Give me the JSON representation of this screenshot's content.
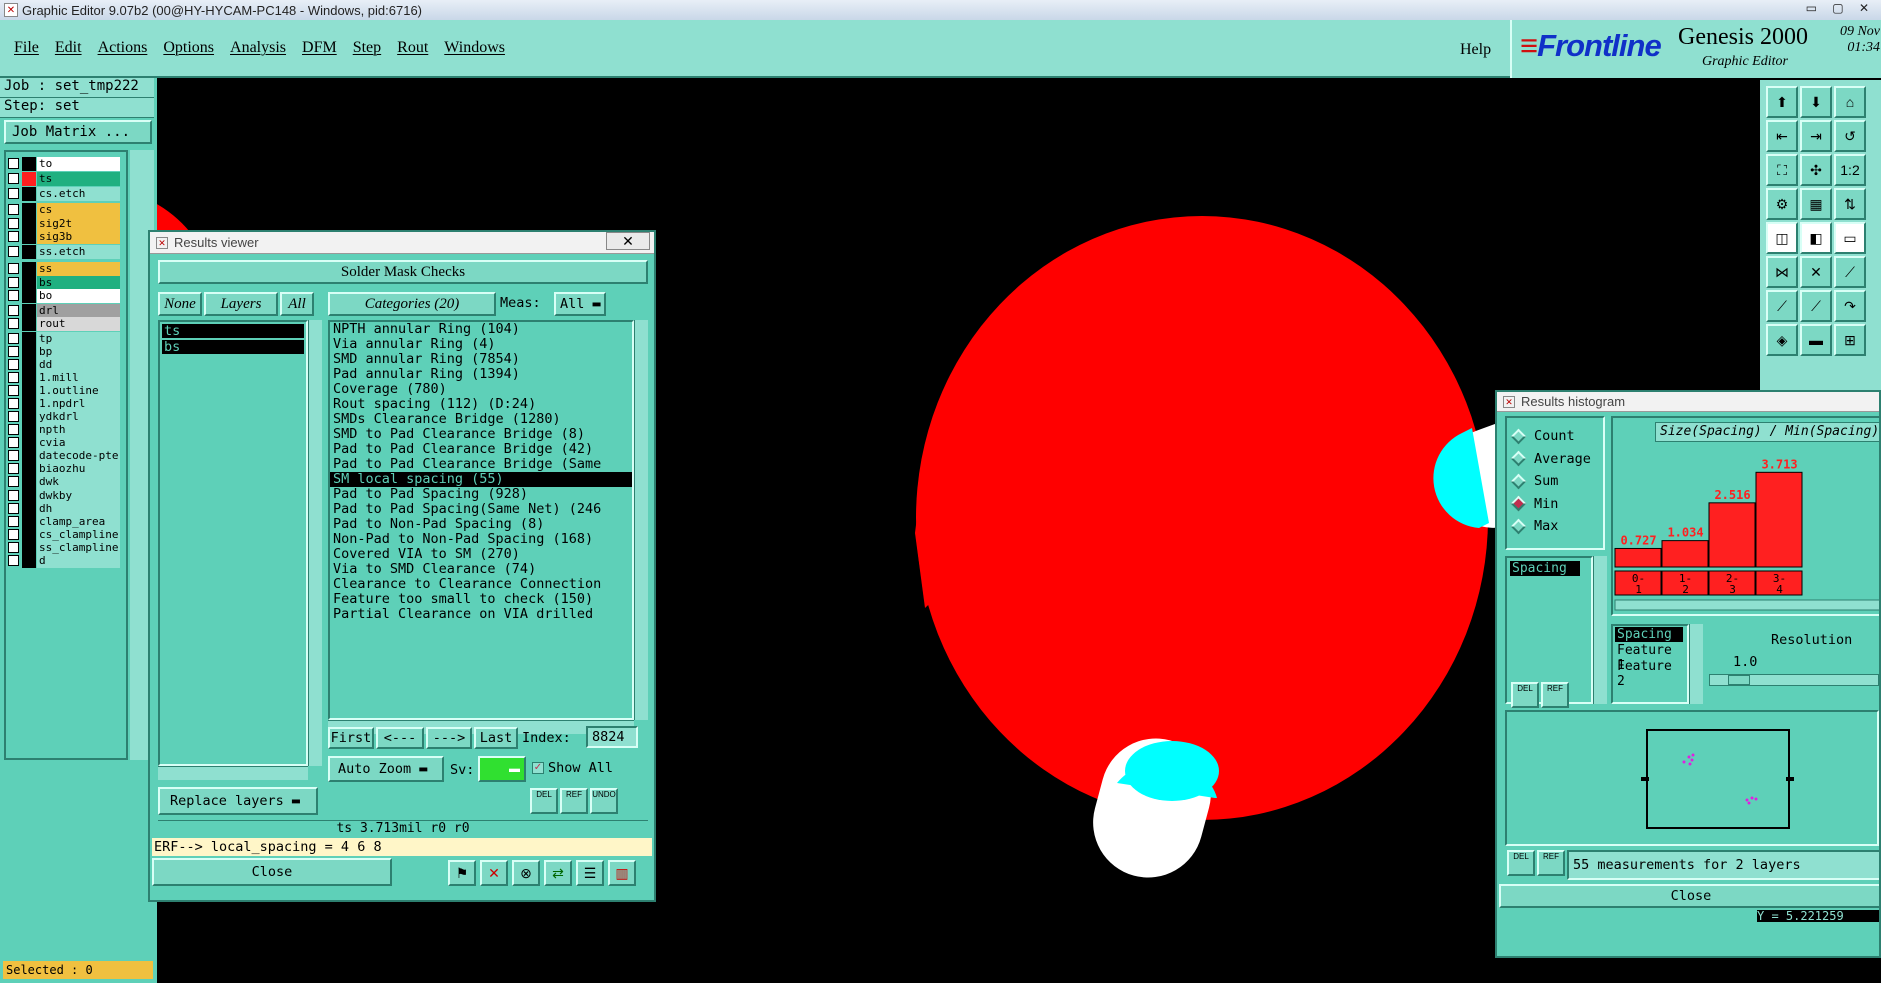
{
  "window": {
    "title": "Graphic Editor 9.07b2 (00@HY-HYCAM-PC148 - Windows, pid:6716)"
  },
  "menu": [
    "File",
    "Edit",
    "Actions",
    "Options",
    "Analysis",
    "DFM",
    "Step",
    "Rout",
    "Windows"
  ],
  "help": "Help",
  "brand": {
    "logo": "Frontline",
    "product": "Genesis 2000",
    "subtitle": "Graphic Editor",
    "date": "09  Nov",
    "time": "01:34"
  },
  "job": {
    "job_line": "Job : set_tmp222",
    "step_line": "Step: set",
    "job_matrix": "Job Matrix ..."
  },
  "layers": [
    {
      "name": "to",
      "color": "#ffffff",
      "mark": "",
      "active": false
    },
    {
      "name": "ts",
      "color": "#20b080",
      "mark": "#",
      "active": true
    },
    {
      "name": "cs.etch",
      "color": "#8fe0d0",
      "mark": "",
      "active": false
    },
    {
      "name": "cs",
      "color": "#f0c040",
      "mark": "",
      "active": false
    },
    {
      "name": "sig2t",
      "color": "#f0c040",
      "mark": "",
      "active": false
    },
    {
      "name": "sig3b",
      "color": "#f0c040",
      "mark": "",
      "active": false
    },
    {
      "name": "ss.etch",
      "color": "#8fe0d0",
      "mark": "",
      "active": false
    },
    {
      "name": "ss",
      "color": "#f0c040",
      "mark": "",
      "active": false
    },
    {
      "name": "bs",
      "color": "#20b080",
      "mark": "",
      "active": false
    },
    {
      "name": "bo",
      "color": "#ffffff",
      "mark": "",
      "active": false
    },
    {
      "name": "drl",
      "color": "#a0a0a0",
      "mark": "",
      "active": false
    },
    {
      "name": "rout",
      "color": "#d8d8d8",
      "mark": "",
      "active": false
    },
    {
      "name": "tp",
      "color": "#8fe0d0",
      "mark": "",
      "active": false
    },
    {
      "name": "bp",
      "color": "#8fe0d0",
      "mark": "",
      "active": false
    },
    {
      "name": "dd",
      "color": "#8fe0d0",
      "mark": "",
      "active": false
    },
    {
      "name": "1.mill",
      "color": "#8fe0d0",
      "mark": "",
      "active": false
    },
    {
      "name": "1.outline",
      "color": "#8fe0d0",
      "mark": "",
      "active": false
    },
    {
      "name": "1.npdrl",
      "color": "#8fe0d0",
      "mark": "",
      "active": false
    },
    {
      "name": "ydkdrl",
      "color": "#8fe0d0",
      "mark": "",
      "active": false
    },
    {
      "name": "npth",
      "color": "#8fe0d0",
      "mark": "",
      "active": false
    },
    {
      "name": "cvia",
      "color": "#8fe0d0",
      "mark": "",
      "active": false
    },
    {
      "name": "datecode-pte",
      "color": "#8fe0d0",
      "mark": "",
      "active": false
    },
    {
      "name": "biaozhu",
      "color": "#8fe0d0",
      "mark": "",
      "active": false
    },
    {
      "name": "dwk",
      "color": "#8fe0d0",
      "mark": "",
      "active": false
    },
    {
      "name": "dwkby",
      "color": "#8fe0d0",
      "mark": "",
      "active": false
    },
    {
      "name": "dh",
      "color": "#8fe0d0",
      "mark": "",
      "active": false
    },
    {
      "name": "clamp_area",
      "color": "#8fe0d0",
      "mark": "",
      "active": false
    },
    {
      "name": "cs_clampline",
      "color": "#8fe0d0",
      "mark": "",
      "active": false
    },
    {
      "name": "ss_clampline",
      "color": "#8fe0d0",
      "mark": "",
      "active": false
    },
    {
      "name": "d",
      "color": "#8fe0d0",
      "mark": "",
      "active": false
    }
  ],
  "selected": "Selected : 0",
  "results_viewer": {
    "title": "Results viewer",
    "close_x": "✕",
    "header": "Solder Mask Checks",
    "tab_none": "None",
    "tab_layers": "Layers",
    "tab_all": "All",
    "categories_tab": "Categories (20)",
    "meas_label": "Meas:",
    "meas_value": "All",
    "layers": [
      "ts",
      "bs"
    ],
    "categories": [
      "NPTH annular Ring (104)",
      "Via annular Ring (4)",
      "SMD annular Ring (7854)",
      "Pad annular Ring (1394)",
      "Coverage (780)",
      "Rout spacing (112)       (D:24)",
      "SMDs Clearance Bridge (1280)",
      "SMD to Pad Clearance Bridge (8)",
      "Pad to Pad Clearance Bridge (42)",
      "Pad to Pad Clearance Bridge (Same",
      "SM local spacing (55)",
      "Pad to Pad Spacing (928)",
      "Pad to Pad Spacing(Same Net) (246",
      "Pad to Non-Pad Spacing (8)",
      "Non-Pad to Non-Pad Spacing (168)",
      "Covered VIA to SM (270)",
      "Via to SMD Clearance (74)",
      "Clearance to Clearance Connection",
      "Feature too small to check (150)",
      "Partial Clearance on VIA drilled"
    ],
    "selected_index": 10,
    "first": "First",
    "prev": "<---",
    "next": "--->",
    "last": "Last",
    "index_label": "Index:",
    "index_value": "8824",
    "auto_zoom": "Auto Zoom",
    "sv_label": "Sv:",
    "show_all": "Show All",
    "replace_layers": "Replace layers",
    "del": "DEL",
    "ref": "REF",
    "undo": "UNDO",
    "status": "ts 3.713mil  r0  r0",
    "erf": "ERF--> local_spacing = 4 6 8",
    "close": "Close"
  },
  "histogram": {
    "title": "Results histogram",
    "radios": [
      "Count",
      "Average",
      "Sum",
      "Min",
      "Max"
    ],
    "selected_radio": "Min",
    "list_item": "Spacing",
    "chart_title": "Size(Spacing) / Min(Spacing)",
    "resolution_label": "Resolution",
    "resolution_value": "1.0",
    "feature_items": [
      "Spacing",
      "Feature 1",
      "Feature 2"
    ],
    "footer": "55 measurements for 2 layers",
    "close": "Close",
    "y_readout": "Y = 5.221259",
    "del": "DEL",
    "ref": "REF"
  },
  "chart_data": {
    "type": "bar",
    "categories": [
      "0-1",
      "1-2",
      "2-3",
      "3-4"
    ],
    "values": [
      0.727,
      1.034,
      2.516,
      3.713
    ],
    "title": "Size(Spacing) / Min(Spacing)",
    "xlabel": "",
    "ylabel": "",
    "ylim": [
      0,
      4
    ],
    "bar_color": "#ff2020",
    "label_color": "#ff2020"
  },
  "colors": {
    "pad": "#ff0000",
    "highlight": "#00ffff",
    "clearance": "#ffffff"
  }
}
